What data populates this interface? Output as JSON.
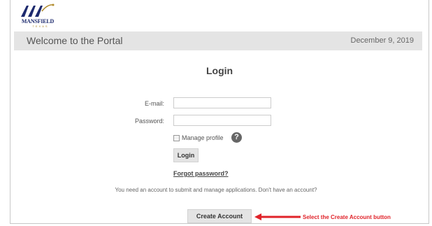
{
  "logo": {
    "name": "MANSFIELD",
    "sub": "TEXAS"
  },
  "header": {
    "title": "Welcome to the Portal",
    "date": "December 9, 2019"
  },
  "login": {
    "title": "Login",
    "email_label": "E-mail:",
    "email_value": "",
    "password_label": "Password:",
    "password_value": "",
    "manage_profile_label": "Manage profile",
    "help_icon": "?",
    "login_button": "Login",
    "forgot_password": "Forgot password?"
  },
  "info_text": "You need an account to submit and manage applications. Don't have an account?",
  "create_account_button": "Create Account",
  "annotation": {
    "text": "Select the Create Account button",
    "color": "#e0232a"
  },
  "icons": [
    "mansfield-logo-icon",
    "help-icon",
    "checkbox-icon",
    "red-arrow-icon"
  ]
}
